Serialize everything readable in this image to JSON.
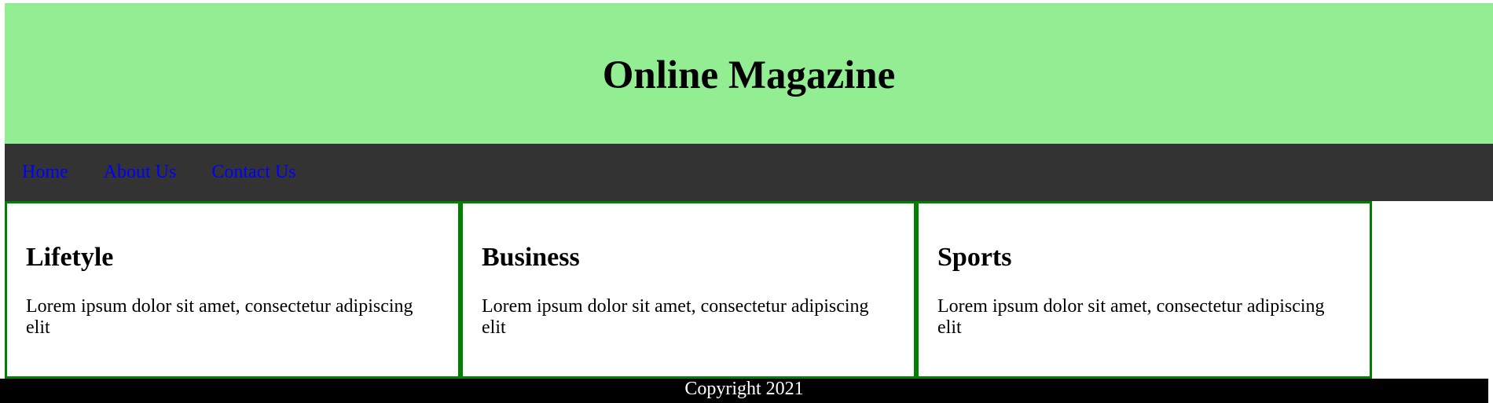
{
  "header": {
    "title": "Online Magazine"
  },
  "nav": {
    "items": [
      {
        "label": "Home"
      },
      {
        "label": "About Us"
      },
      {
        "label": "Contact Us"
      }
    ]
  },
  "cards": [
    {
      "title": "Lifetyle",
      "text": "Lorem ipsum dolor sit amet, consectetur adipiscing elit"
    },
    {
      "title": "Business",
      "text": "Lorem ipsum dolor sit amet, consectetur adipiscing elit"
    },
    {
      "title": "Sports",
      "text": "Lorem ipsum dolor sit amet, consectetur adipiscing elit"
    }
  ],
  "footer": {
    "text": "Copyright 2021"
  },
  "colors": {
    "header_bg": "#93ee93",
    "nav_bg": "#333333",
    "link": "#0000ff",
    "card_border": "#008000",
    "footer_bg": "#000000"
  }
}
